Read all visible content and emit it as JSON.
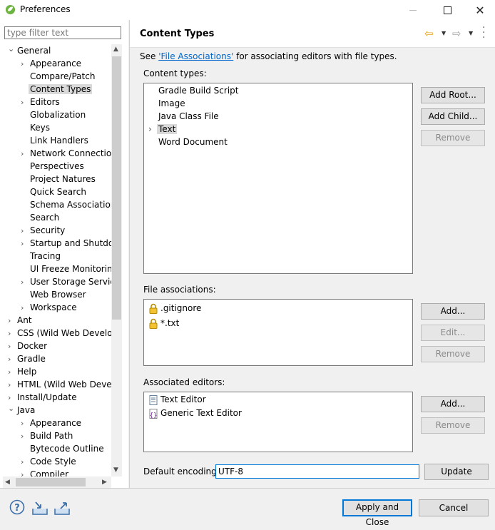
{
  "window": {
    "title": "Preferences"
  },
  "filter": {
    "placeholder": "type filter text"
  },
  "tree": [
    {
      "label": "General",
      "level": 0,
      "chev": "v"
    },
    {
      "label": "Appearance",
      "level": 1,
      "chev": ">"
    },
    {
      "label": "Compare/Patch",
      "level": 1,
      "chev": ""
    },
    {
      "label": "Content Types",
      "level": 1,
      "chev": "",
      "selected": true
    },
    {
      "label": "Editors",
      "level": 1,
      "chev": ">"
    },
    {
      "label": "Globalization",
      "level": 1,
      "chev": ""
    },
    {
      "label": "Keys",
      "level": 1,
      "chev": ""
    },
    {
      "label": "Link Handlers",
      "level": 1,
      "chev": ""
    },
    {
      "label": "Network Connections",
      "level": 1,
      "chev": ">"
    },
    {
      "label": "Perspectives",
      "level": 1,
      "chev": ""
    },
    {
      "label": "Project Natures",
      "level": 1,
      "chev": ""
    },
    {
      "label": "Quick Search",
      "level": 1,
      "chev": ""
    },
    {
      "label": "Schema Associations",
      "level": 1,
      "chev": ""
    },
    {
      "label": "Search",
      "level": 1,
      "chev": ""
    },
    {
      "label": "Security",
      "level": 1,
      "chev": ">"
    },
    {
      "label": "Startup and Shutdown",
      "level": 1,
      "chev": ">"
    },
    {
      "label": "Tracing",
      "level": 1,
      "chev": ""
    },
    {
      "label": "UI Freeze Monitoring",
      "level": 1,
      "chev": ""
    },
    {
      "label": "User Storage Service",
      "level": 1,
      "chev": ">"
    },
    {
      "label": "Web Browser",
      "level": 1,
      "chev": ""
    },
    {
      "label": "Workspace",
      "level": 1,
      "chev": ">"
    },
    {
      "label": "Ant",
      "level": 0,
      "chev": ">"
    },
    {
      "label": "CSS (Wild Web Developer)",
      "level": 0,
      "chev": ">"
    },
    {
      "label": "Docker",
      "level": 0,
      "chev": ">"
    },
    {
      "label": "Gradle",
      "level": 0,
      "chev": ">"
    },
    {
      "label": "Help",
      "level": 0,
      "chev": ">"
    },
    {
      "label": "HTML (Wild Web Developer)",
      "level": 0,
      "chev": ">"
    },
    {
      "label": "Install/Update",
      "level": 0,
      "chev": ">"
    },
    {
      "label": "Java",
      "level": 0,
      "chev": "v"
    },
    {
      "label": "Appearance",
      "level": 1,
      "chev": ">"
    },
    {
      "label": "Build Path",
      "level": 1,
      "chev": ">"
    },
    {
      "label": "Bytecode Outline",
      "level": 1,
      "chev": ""
    },
    {
      "label": "Code Style",
      "level": 1,
      "chev": ">"
    },
    {
      "label": "Compiler",
      "level": 1,
      "chev": ">"
    }
  ],
  "page": {
    "title": "Content Types",
    "see_prefix": "See ",
    "see_link": "'File Associations'",
    "see_suffix": " for associating editors with file types.",
    "content_types_label": "Content types:",
    "content_types": [
      {
        "label": "Gradle Build Script",
        "chev": ""
      },
      {
        "label": "Image",
        "chev": ""
      },
      {
        "label": "Java Class File",
        "chev": ""
      },
      {
        "label": "Text",
        "chev": ">",
        "selected": true
      },
      {
        "label": "Word Document",
        "chev": ""
      }
    ],
    "add_root": "Add Root...",
    "add_child": "Add Child...",
    "remove": "Remove",
    "file_assoc_label": "File associations:",
    "file_assoc": [
      ".gitignore",
      "*.txt"
    ],
    "add": "Add...",
    "edit": "Edit...",
    "assoc_editors_label": "Associated editors:",
    "assoc_editors": [
      "Text Editor",
      "Generic Text Editor"
    ],
    "encoding_label": "Default encoding:",
    "encoding_value": "UTF-8",
    "update": "Update"
  },
  "footer": {
    "apply_close": "Apply and Close",
    "cancel": "Cancel"
  }
}
